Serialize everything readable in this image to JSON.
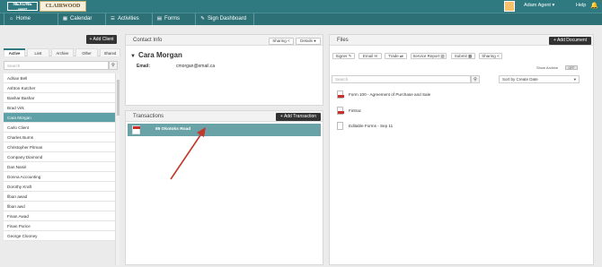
{
  "topbar": {
    "logo_primary": "NEXONE",
    "logo_secondary": "CLAIRWOOD",
    "user": "Adam Agent ▾",
    "help": "Help"
  },
  "nav": [
    {
      "icon": "home-icon",
      "glyph": "⌂",
      "label": "Home"
    },
    {
      "icon": "calendar-icon",
      "glyph": "▦",
      "label": "Calendar"
    },
    {
      "icon": "list-icon",
      "glyph": "☰",
      "label": "Activities"
    },
    {
      "icon": "forms-icon",
      "glyph": "▤",
      "label": "Forms"
    },
    {
      "icon": "signature-icon",
      "glyph": "✎",
      "label": "Sign Dashboard"
    }
  ],
  "clients": {
    "add_button": "+ Add Client",
    "tabs": [
      "Active",
      "Lost",
      "Archive",
      "Other",
      "Shared"
    ],
    "search_placeholder": "Search",
    "items": [
      "Adrian Bell",
      "Ashton Kutcher",
      "Bashar Bashar",
      "Brad Virk",
      "Cara Morgan",
      "Carlo Client",
      "Charles Burns",
      "Christopher Pitman",
      "Company Diamond",
      "Dan Nasiri",
      "Donna Accounting",
      "Dorothy Kraft",
      "fiban awad",
      "fiban awd",
      "Finan Awad",
      "Finan Purice",
      "George Clooney"
    ],
    "selected_index": 4
  },
  "contact": {
    "header": "Contact Info",
    "sharing_label": "Sharing",
    "details_label": "Details",
    "name": "Cara Morgan",
    "email_label": "Email:",
    "email_value": "cmorgan@email.ca"
  },
  "transactions": {
    "header": "Transactions",
    "add_button": "+ Add Transaction",
    "row_label": "89 Okotoks Road"
  },
  "files": {
    "header": "Files",
    "add_button": "+ Add Document",
    "actions": [
      "Signer",
      "Email",
      "Trade",
      "Service Report",
      "Submit",
      "Sharing"
    ],
    "show_archive_label": "Show Archive",
    "toggle_label": "OFF",
    "search_placeholder": "Search",
    "sort_label": "Sort by Create Date",
    "items": [
      {
        "name": "Form 100 - Agreement of Purchase and Sale",
        "type": "pdf"
      },
      {
        "name": "Fintrac",
        "type": "pdf"
      },
      {
        "name": "Editable Forms - Sep 11",
        "type": "doc"
      }
    ]
  },
  "colors": {
    "brand_teal": "#2e7a80",
    "selected_row": "#5ea1a6",
    "annotation_arrow": "#c0392b"
  }
}
